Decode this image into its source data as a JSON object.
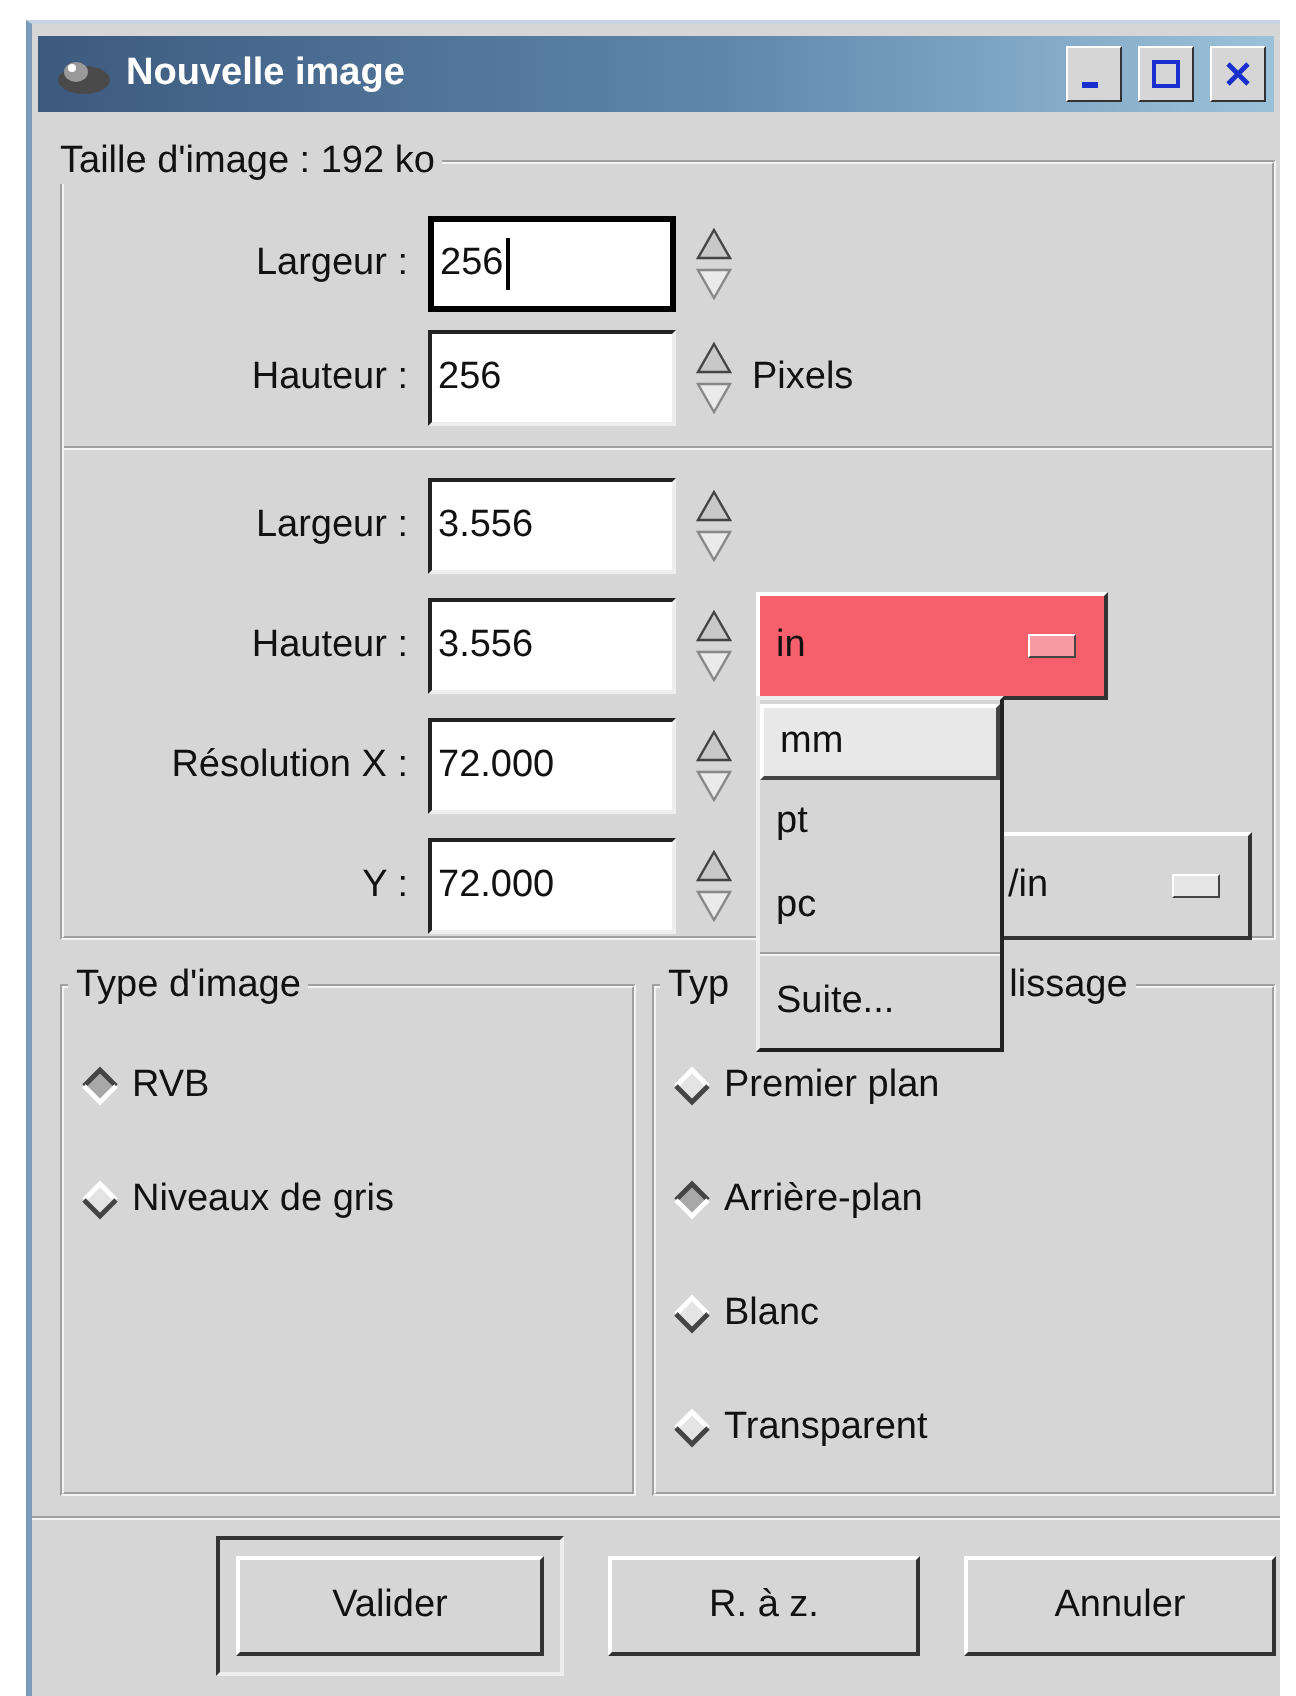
{
  "window": {
    "title": "Nouvelle image"
  },
  "size_frame": {
    "title": "Taille d'image : 192 ko",
    "pixel_fields": [
      {
        "label": "Largeur :",
        "value": "256",
        "focused": true
      },
      {
        "label": "Hauteur :",
        "value": "256",
        "focused": false
      }
    ],
    "pixel_unit": "Pixels",
    "physical_fields": [
      {
        "label": "Largeur :",
        "value": "3.556",
        "focused": false
      },
      {
        "label": "Hauteur :",
        "value": "3.556",
        "focused": false
      }
    ],
    "resolution_fields": [
      {
        "label": "Résolution X :",
        "value": "72.000",
        "focused": false
      },
      {
        "label": "Y :",
        "value": "72.000",
        "focused": false
      }
    ],
    "size_unit_menu": {
      "value": "in",
      "items": [
        {
          "label": "mm",
          "kind": "unit",
          "selected": true
        },
        {
          "label": "pt",
          "kind": "unit",
          "selected": false
        },
        {
          "label": "pc",
          "kind": "unit",
          "selected": false
        },
        {
          "label": "Suite...",
          "kind": "more",
          "selected": false
        }
      ]
    },
    "resolution_unit": "/in"
  },
  "image_type": {
    "title": "Type d'image",
    "options": [
      {
        "label": "RVB",
        "selected": true
      },
      {
        "label": "Niveaux de gris",
        "selected": false
      }
    ]
  },
  "fill_type": {
    "title_parts": [
      "Typ",
      "lissage"
    ],
    "options": [
      {
        "label": "Premier plan",
        "selected": false
      },
      {
        "label": "Arrière-plan",
        "selected": true
      },
      {
        "label": "Blanc",
        "selected": false
      },
      {
        "label": "Transparent",
        "selected": false
      }
    ]
  },
  "buttons": [
    {
      "label": "Valider",
      "default": true
    },
    {
      "label": "R. à z.",
      "default": false
    },
    {
      "label": "Annuler",
      "default": false
    }
  ]
}
